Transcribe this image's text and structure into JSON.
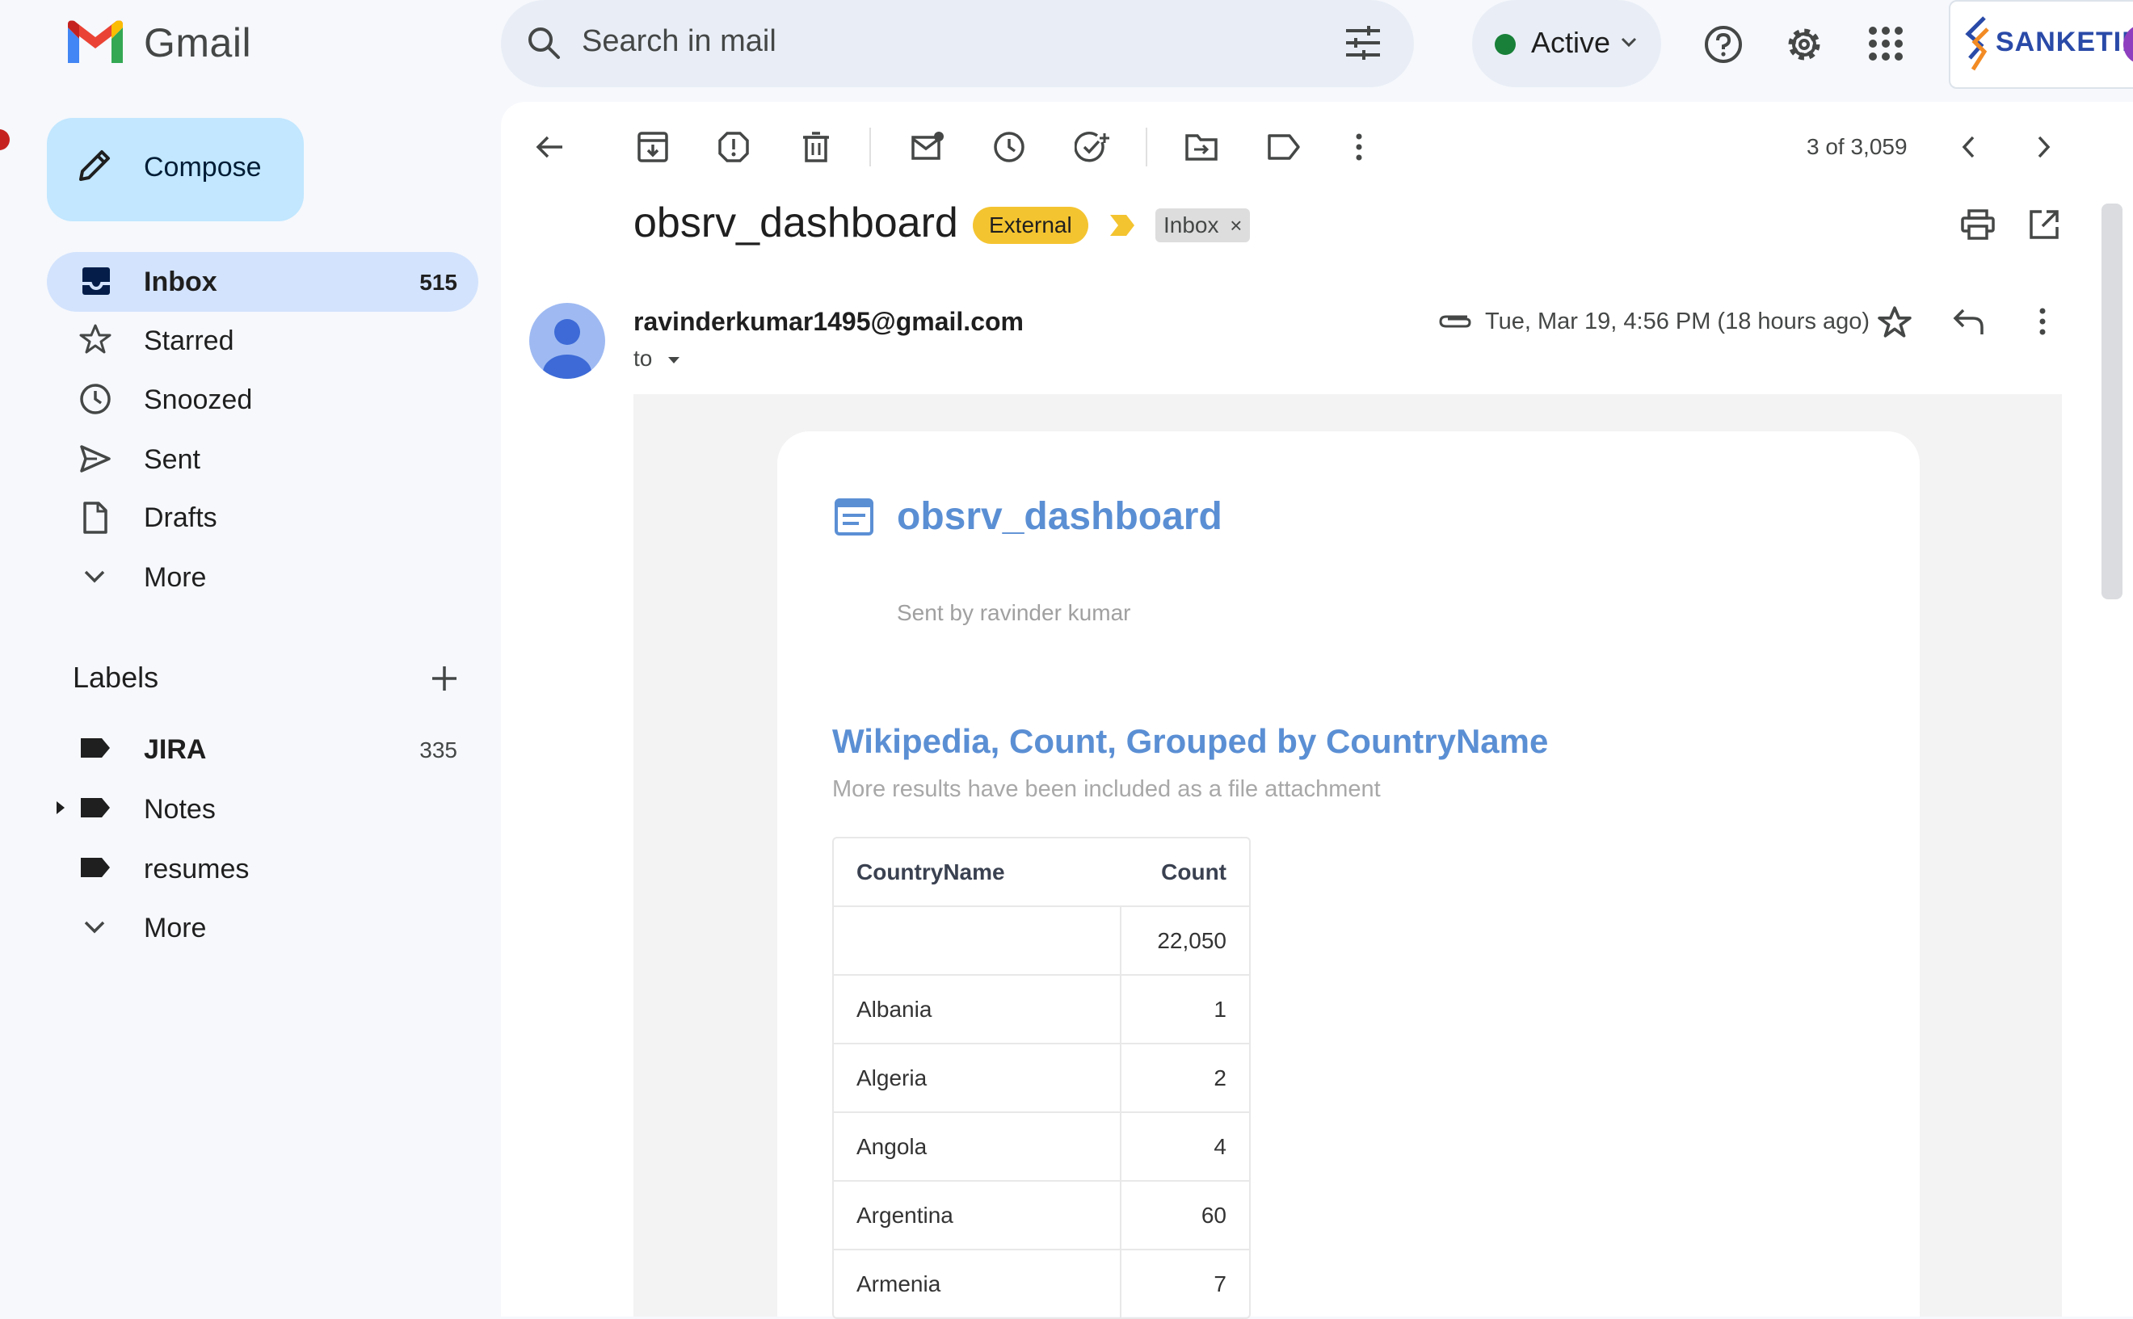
{
  "app": {
    "name": "Gmail"
  },
  "search": {
    "placeholder": "Search in mail"
  },
  "status": {
    "label": "Active",
    "color": "#188038"
  },
  "brand": {
    "text": "SANKETIKA"
  },
  "compose": {
    "label": "Compose"
  },
  "nav": [
    {
      "label": "Inbox",
      "count": "515",
      "icon": "inbox-icon"
    },
    {
      "label": "Starred",
      "count": "",
      "icon": "star-icon"
    },
    {
      "label": "Snoozed",
      "count": "",
      "icon": "clock-icon"
    },
    {
      "label": "Sent",
      "count": "",
      "icon": "send-icon"
    },
    {
      "label": "Drafts",
      "count": "",
      "icon": "draft-icon"
    },
    {
      "label": "More",
      "count": "",
      "icon": "chevron-down-icon"
    }
  ],
  "labels": {
    "title": "Labels",
    "items": [
      {
        "label": "JIRA",
        "count": "335"
      },
      {
        "label": "Notes",
        "count": ""
      },
      {
        "label": "resumes",
        "count": ""
      },
      {
        "label": "More",
        "count": ""
      }
    ]
  },
  "toolbar": {
    "counter": "3 of 3,059"
  },
  "email": {
    "subject": "obsrv_dashboard",
    "badge_external": "External",
    "badge_inbox": "Inbox",
    "sender": "ravinderkumar1495@gmail.com",
    "to": "to",
    "date": "Tue, Mar 19, 4:56 PM (18 hours ago)"
  },
  "body": {
    "dashboard_title": "obsrv_dashboard",
    "sent_by": "Sent by ravinder kumar",
    "chart_title": "Wikipedia, Count, Grouped by CountryName",
    "chart_subtitle": "More results have been included as a file attachment"
  },
  "table": {
    "headers": [
      "CountryName",
      "Count"
    ],
    "rows": [
      [
        "",
        "22,050"
      ],
      [
        "Albania",
        "1"
      ],
      [
        "Algeria",
        "2"
      ],
      [
        "Angola",
        "4"
      ],
      [
        "Argentina",
        "60"
      ],
      [
        "Armenia",
        "7"
      ]
    ]
  }
}
